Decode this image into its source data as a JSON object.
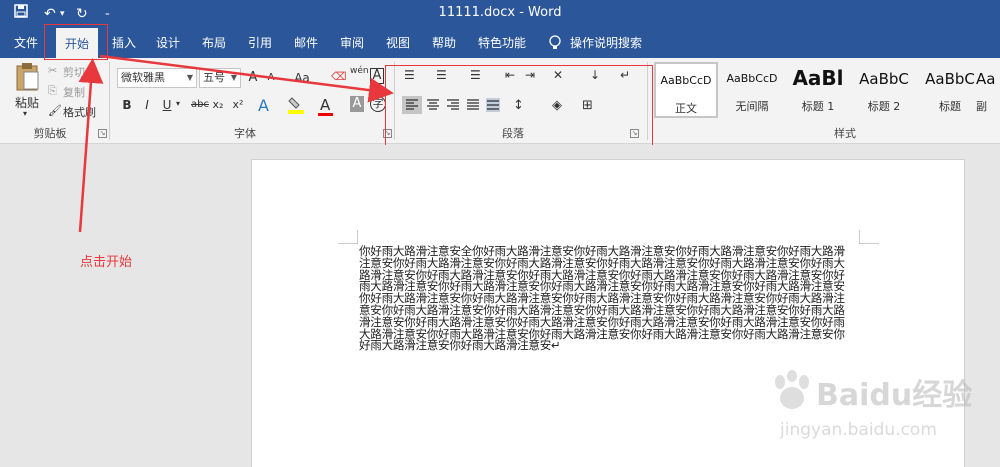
{
  "app": {
    "title": "11111.docx  -  Word"
  },
  "quick_access": {
    "save_icon": "save-icon",
    "undo_icon": "undo-icon",
    "redo_icon": "redo-icon",
    "customize_icon": "customize-qa-icon"
  },
  "tabs": [
    {
      "label": "文件"
    },
    {
      "label": "开始"
    },
    {
      "label": "插入"
    },
    {
      "label": "设计"
    },
    {
      "label": "布局"
    },
    {
      "label": "引用"
    },
    {
      "label": "邮件"
    },
    {
      "label": "审阅"
    },
    {
      "label": "视图"
    },
    {
      "label": "帮助"
    },
    {
      "label": "特色功能"
    },
    {
      "label": "操作说明搜索"
    }
  ],
  "clipboard": {
    "paste_label": "粘贴",
    "cut_label": "剪切",
    "copy_label": "复制",
    "format_painter_label": "格式刷",
    "group_label": "剪贴板"
  },
  "font": {
    "family": "微软雅黑",
    "size": "五号",
    "group_label": "字体",
    "grow_label": "A",
    "shrink_label": "A",
    "case_label": "Aa",
    "phonetic_label": "wén",
    "bold": "B",
    "italic": "I",
    "underline": "U",
    "strike": "abc",
    "subscript": "x₂",
    "superscript": "x²"
  },
  "paragraph": {
    "group_label": "段落"
  },
  "styles": {
    "group_label": "样式",
    "items": [
      {
        "sample": "AaBbCcD",
        "name": "正文"
      },
      {
        "sample": "AaBbCcD",
        "name": "无间隔"
      },
      {
        "sample": "AaBl",
        "name": "标题 1"
      },
      {
        "sample": "AaBbC",
        "name": "标题 2"
      },
      {
        "sample": "AaBbC",
        "name": "标题"
      },
      {
        "sample": "Aa",
        "name": "副"
      }
    ]
  },
  "document": {
    "text": "你好雨大路滑注意安全你好雨大路滑注意安你好雨大路滑注意安你好雨大路滑注意安你好雨大路滑注意安你好雨大路滑注意安你好雨大路滑注意安你好雨大路滑注意安你好雨大路滑注意安你好雨大路滑注意安你好雨大路滑注意安你好雨大路滑注意安你好雨大路滑注意安你好雨大路滑注意安你好雨大路滑注意安你好雨大路滑注意安你好雨大路滑注意安你好雨大路滑注意安你好雨大路滑注意安你好雨大路滑注意安你好雨大路滑注意安你好雨大路滑注意安你好雨大路滑注意安你好雨大路滑注意安你好雨大路滑注意安你好雨大路滑注意安你好雨大路滑注意安你好雨大路滑注意安你好雨大路滑注意安你好雨大路滑注意安你好雨大路滑注意安你好雨大路滑注意安你好雨大路滑注意安你好雨大路滑注意安你好雨大路滑注意安你好雨大路滑注意安你好雨大路滑注意安你好雨大路滑注意安你好雨大路滑注意安你好雨大路滑注意安↵"
  },
  "annotation": {
    "label": "点击开始",
    "color": "#e8383d"
  },
  "watermark": {
    "brand": "Baidu经验",
    "url": "jingyan.baidu.com"
  },
  "colors": {
    "accent": "#2b579a",
    "annotation": "#e8383d"
  }
}
